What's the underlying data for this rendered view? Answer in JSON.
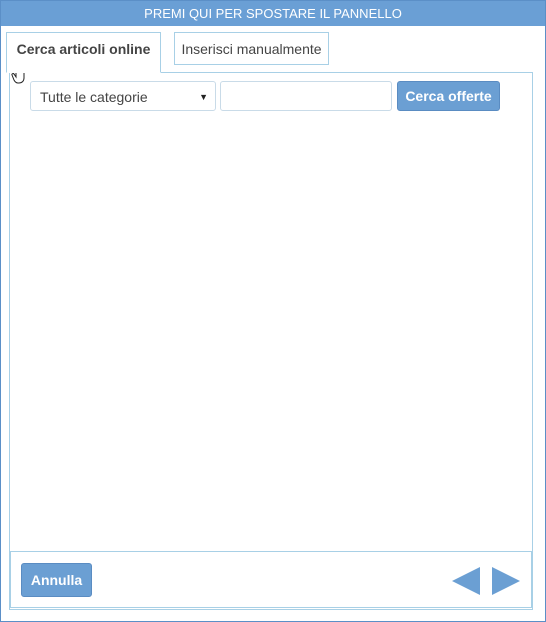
{
  "header": {
    "title": "PREMI QUI PER SPOSTARE IL PANNELLO"
  },
  "tabs": [
    {
      "label": "Cerca articoli online",
      "active": true
    },
    {
      "label": "Inserisci manualmente",
      "active": false
    }
  ],
  "search": {
    "category_selected": "Tutte le categorie",
    "query_value": "",
    "button_label": "Cerca offerte"
  },
  "footer": {
    "cancel_label": "Annulla",
    "prev_icon": "arrow-left-icon",
    "next_icon": "arrow-right-icon"
  },
  "colors": {
    "accent": "#6a9fd5",
    "border": "#a8d0e6"
  }
}
